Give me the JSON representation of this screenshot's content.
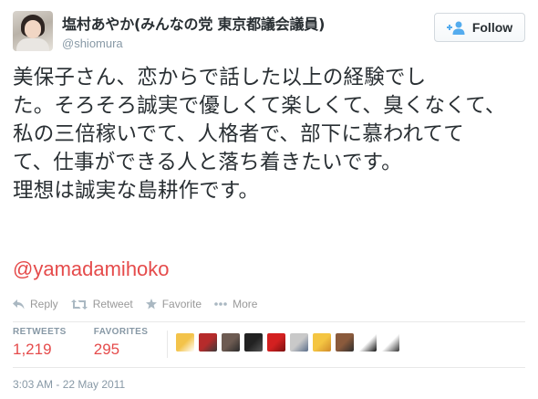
{
  "user": {
    "fullname": "塩村あやか(みんなの党 東京都議会議員)",
    "screenname": "@shiomura"
  },
  "follow_button": {
    "label": "Follow",
    "icon": "follow-person-plus-icon"
  },
  "tweet": {
    "lines": [
      "美保子さん、恋からで話した以上の経験でし",
      "た。そろそろ誠実で優しくて楽しくて、臭くなくて、",
      "私の三倍稼いでて、人格者で、部下に慕われてて",
      "て、仕事ができる人と落ち着きたいです。",
      "理想は誠実な島耕作です。"
    ],
    "mention": "@yamadamihoko"
  },
  "actions": [
    {
      "label": "Reply",
      "icon": "reply-icon"
    },
    {
      "label": "Retweet",
      "icon": "retweet-icon"
    },
    {
      "label": "Favorite",
      "icon": "star-icon"
    },
    {
      "label": "More",
      "icon": "more-dots-icon"
    }
  ],
  "stats": {
    "retweets_label": "RETWEETS",
    "retweets_value": "1,219",
    "favorites_label": "FAVORITES",
    "favorites_value": "295"
  },
  "favoriter_avatars": [
    {
      "name": "favoriter-avatar-1",
      "colors": [
        "#f3c34a",
        "#ffffff"
      ]
    },
    {
      "name": "favoriter-avatar-2",
      "colors": [
        "#b62b2b",
        "#3a3a3a"
      ]
    },
    {
      "name": "favoriter-avatar-3",
      "colors": [
        "#6d5b52",
        "#2b2b2b"
      ]
    },
    {
      "name": "favoriter-avatar-4",
      "colors": [
        "#222222",
        "#555555"
      ]
    },
    {
      "name": "favoriter-avatar-5",
      "colors": [
        "#d32020",
        "#7a1010"
      ]
    },
    {
      "name": "favoriter-avatar-6",
      "colors": [
        "#c9c9c9",
        "#5b6e8a"
      ]
    },
    {
      "name": "favoriter-avatar-7",
      "colors": [
        "#f4c542",
        "#d08a2a"
      ]
    },
    {
      "name": "favoriter-avatar-8",
      "colors": [
        "#8a5a3c",
        "#2e2e2e"
      ]
    },
    {
      "name": "favoriter-avatar-9",
      "colors": [
        "#ffffff",
        "#111111"
      ]
    },
    {
      "name": "favoriter-avatar-10",
      "colors": [
        "#ffffff",
        "#333333"
      ]
    }
  ],
  "timestamp": "3:03 AM - 22 May 2011",
  "colors": {
    "link": "#e54b4b",
    "muted": "#8899a6",
    "text": "#292f33"
  }
}
